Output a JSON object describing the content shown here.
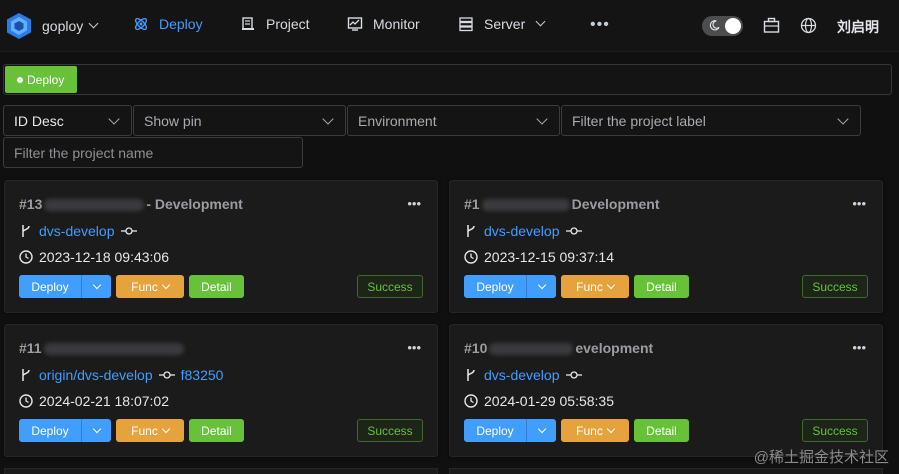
{
  "app": {
    "brand": "goploy",
    "user": "刘启明"
  },
  "nav": [
    {
      "label": "Deploy",
      "icon": "deploy-icon",
      "active": true
    },
    {
      "label": "Project",
      "icon": "project-icon",
      "active": false
    },
    {
      "label": "Monitor",
      "icon": "monitor-icon",
      "active": false
    },
    {
      "label": "Server",
      "icon": "server-icon",
      "active": false
    }
  ],
  "tag": {
    "label": "Deploy"
  },
  "filters": {
    "sort": "ID Desc",
    "pin": "Show pin",
    "environment": "Environment",
    "label": "Filter the project label",
    "name": "Filter the project name"
  },
  "cards": [
    {
      "id": "#13",
      "suffix": "- Development",
      "branch": "dvs-develop",
      "commit": "",
      "time": "2023-12-18 09:43:06",
      "status": "Success"
    },
    {
      "id": "#1",
      "suffix": "Development",
      "branch": "dvs-develop",
      "commit": "",
      "time": "2023-12-15 09:37:14",
      "status": "Success"
    },
    {
      "id": "#11",
      "suffix": "",
      "branch": "origin/dvs-develop",
      "commit": "f83250",
      "time": "2024-02-21 18:07:02",
      "status": "Success"
    },
    {
      "id": "#10",
      "suffix": "evelopment",
      "branch": "dvs-develop",
      "commit": "",
      "time": "2024-01-29 05:58:35",
      "status": "Success"
    }
  ],
  "buttons": {
    "deploy": "Deploy",
    "func": "Func",
    "detail": "Detail"
  },
  "watermark": "@稀土掘金技术社区",
  "colors": {
    "primary": "#409eff",
    "warning": "#e6a23c",
    "success": "#67c23a",
    "background": "#101010"
  }
}
